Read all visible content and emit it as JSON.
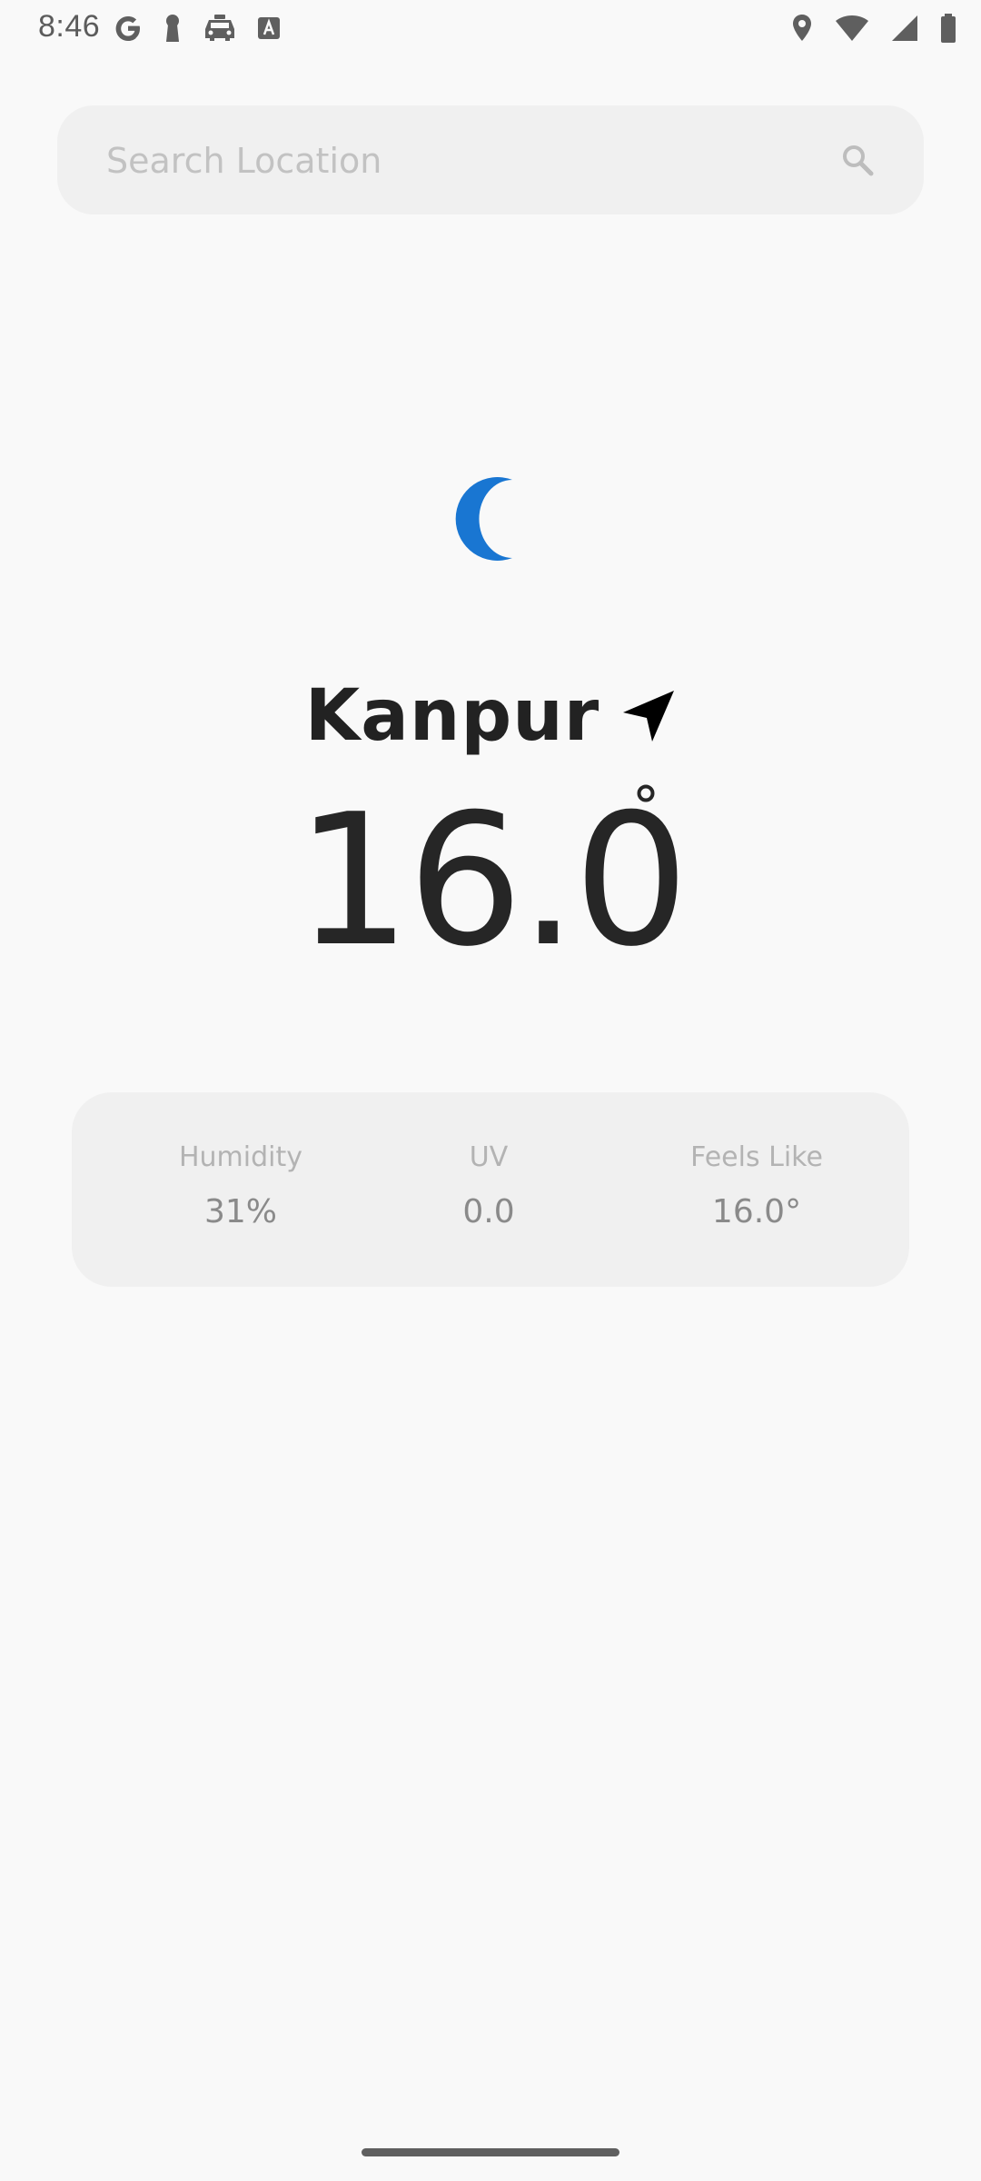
{
  "status_bar": {
    "time": "8:46",
    "left_icons": [
      "google-icon",
      "keyhole-icon",
      "taxi-icon",
      "translate-icon"
    ],
    "right_icons": [
      "location-pin-icon",
      "wifi-icon",
      "signal-icon",
      "battery-icon"
    ]
  },
  "search": {
    "placeholder": "Search Location",
    "value": "",
    "icon": "search-icon"
  },
  "weather": {
    "condition_icon": "crescent-moon-icon",
    "icon_color": "#1976d2",
    "city": "Kanpur",
    "city_icon": "navigation-arrow-icon",
    "temperature": "16.0",
    "temperature_unit_icon": "degree-circle-icon"
  },
  "stats": {
    "humidity": {
      "label": "Humidity",
      "value": "31%"
    },
    "uv": {
      "label": "UV",
      "value": "0.0"
    },
    "feels_like": {
      "label": "Feels Like",
      "value": "16.0°"
    }
  }
}
